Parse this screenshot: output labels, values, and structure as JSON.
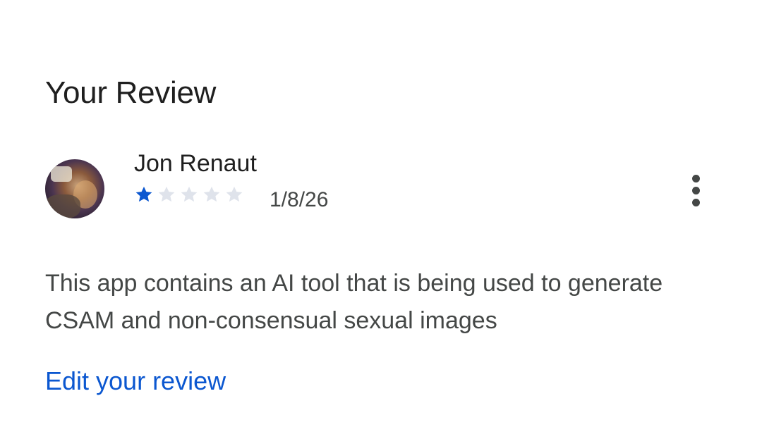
{
  "section": {
    "title": "Your Review"
  },
  "review": {
    "author": "Jon Renaut",
    "rating": 1,
    "max_rating": 5,
    "date": "1/8/26",
    "text": "This app contains an AI tool that is being used to generate CSAM and non-consensual sexual images",
    "edit_label": "Edit your review",
    "more_options_icon": "more-vert-icon"
  },
  "colors": {
    "star_filled": "#0b57d0",
    "star_empty": "#dfe3eb",
    "link": "#0b57d0",
    "title": "#1f1f1f",
    "body_text": "#444746"
  }
}
